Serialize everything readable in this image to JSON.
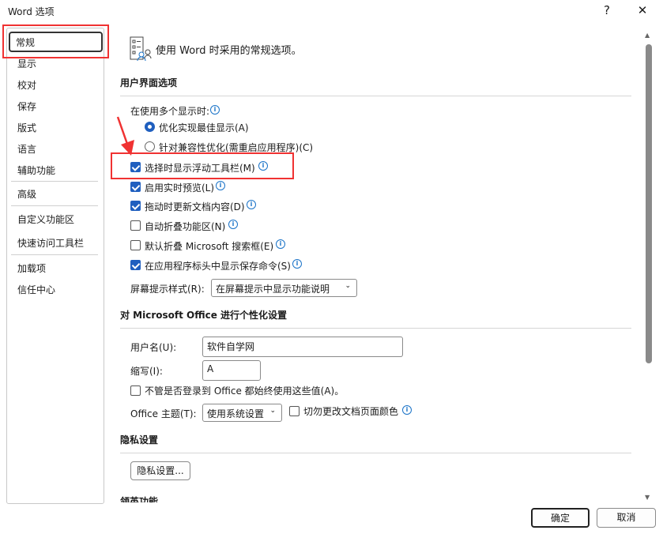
{
  "window": {
    "title": "Word 选项",
    "help": "?",
    "close": "✕"
  },
  "sidebar": {
    "items": [
      {
        "label": "常规",
        "selected": true
      },
      {
        "label": "显示"
      },
      {
        "label": "校对"
      },
      {
        "label": "保存"
      },
      {
        "label": "版式"
      },
      {
        "label": "语言"
      },
      {
        "label": "辅助功能"
      },
      {
        "label": "高级"
      },
      {
        "label": "自定义功能区"
      },
      {
        "label": "快速访问工具栏"
      },
      {
        "label": "加载项"
      },
      {
        "label": "信任中心"
      }
    ]
  },
  "main": {
    "intro": "使用 Word 时采用的常规选项。",
    "ui_section": {
      "title": "用户界面选项",
      "multi_display_label": "在使用多个显示时:",
      "radios": [
        {
          "label": "优化实现最佳显示(A)",
          "checked": true
        },
        {
          "label": "针对兼容性优化(需重启应用程序)(C)",
          "checked": false
        }
      ],
      "checkboxes": [
        {
          "label": "选择时显示浮动工具栏(M)",
          "checked": true
        },
        {
          "label": "启用实时预览(L)",
          "checked": true
        },
        {
          "label": "拖动时更新文档内容(D)",
          "checked": true
        },
        {
          "label": "自动折叠功能区(N)",
          "checked": false
        },
        {
          "label": "默认折叠 Microsoft 搜索框(E)",
          "checked": false
        },
        {
          "label": "在应用程序标头中显示保存命令(S)",
          "checked": true
        }
      ],
      "screentip_label": "屏幕提示样式(R):",
      "screentip_value": "在屏幕提示中显示功能说明"
    },
    "personalize": {
      "title": "对 Microsoft Office 进行个性化设置",
      "username_label": "用户名(U):",
      "username_value": "软件自学网",
      "initials_label": "缩写(I):",
      "initials_value": "A",
      "always_use_label": "不管是否登录到 Office 都始终使用这些值(A)。",
      "always_use_checked": false,
      "theme_label": "Office 主题(T):",
      "theme_value": "使用系统设置",
      "never_change_label": "切勿更改文档页面颜色",
      "never_change_checked": false
    },
    "privacy": {
      "title": "隐私设置",
      "button": "隐私设置..."
    },
    "linkedin": {
      "title": "领英功能"
    }
  },
  "footer": {
    "ok": "确定",
    "cancel": "取消"
  },
  "colors": {
    "accent": "#1f5fbf",
    "annotation": "#f03232"
  }
}
